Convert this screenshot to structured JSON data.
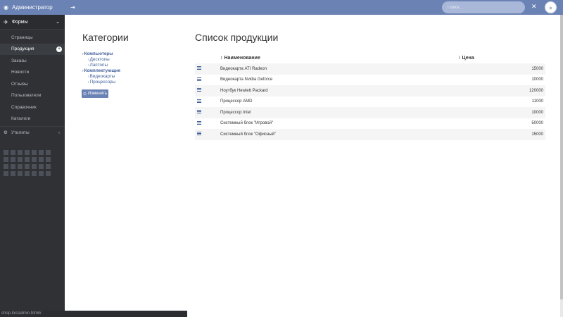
{
  "header": {
    "brand": "Администратор",
    "search_placeholder": "Поиск..."
  },
  "sidebar": {
    "section_forms": "Формы",
    "items": [
      {
        "label": "Страницы",
        "active": false
      },
      {
        "label": "Продукция",
        "active": true
      },
      {
        "label": "Заказы",
        "active": false
      },
      {
        "label": "Новости",
        "active": false
      },
      {
        "label": "Отзывы",
        "active": false
      },
      {
        "label": "Пользователи",
        "active": false
      },
      {
        "label": "Справочник",
        "active": false
      },
      {
        "label": "Каталоги",
        "active": false
      }
    ],
    "section_utils": "Утилиты"
  },
  "categories": {
    "title": "Категории",
    "tree": [
      {
        "label": "Компьютеры",
        "children": [
          "Десктопы",
          "Лаптопы"
        ]
      },
      {
        "label": "Комплектующие",
        "children": [
          "Видеокарты",
          "Процессоры"
        ]
      }
    ],
    "edit_label": "Изменить"
  },
  "products": {
    "title": "Список продукции",
    "col_name": "Наименование",
    "col_price": "Цена",
    "rows": [
      {
        "name": "Видеокарта ATI Radeon",
        "price": "15000"
      },
      {
        "name": "Видеокарта Nvidia Geforce",
        "price": "10000"
      },
      {
        "name": "Ноутбук Hewlett Packard",
        "price": "120000"
      },
      {
        "name": "Процессор AMD",
        "price": "11000"
      },
      {
        "name": "Процессор Intel",
        "price": "10000"
      },
      {
        "name": "Системный блок \"Игровой\"",
        "price": "50000"
      },
      {
        "name": "Системный блок \"Офисный\"",
        "price": "15000"
      }
    ]
  },
  "statusbar": {
    "url": "shop.loc/admin.html#"
  }
}
